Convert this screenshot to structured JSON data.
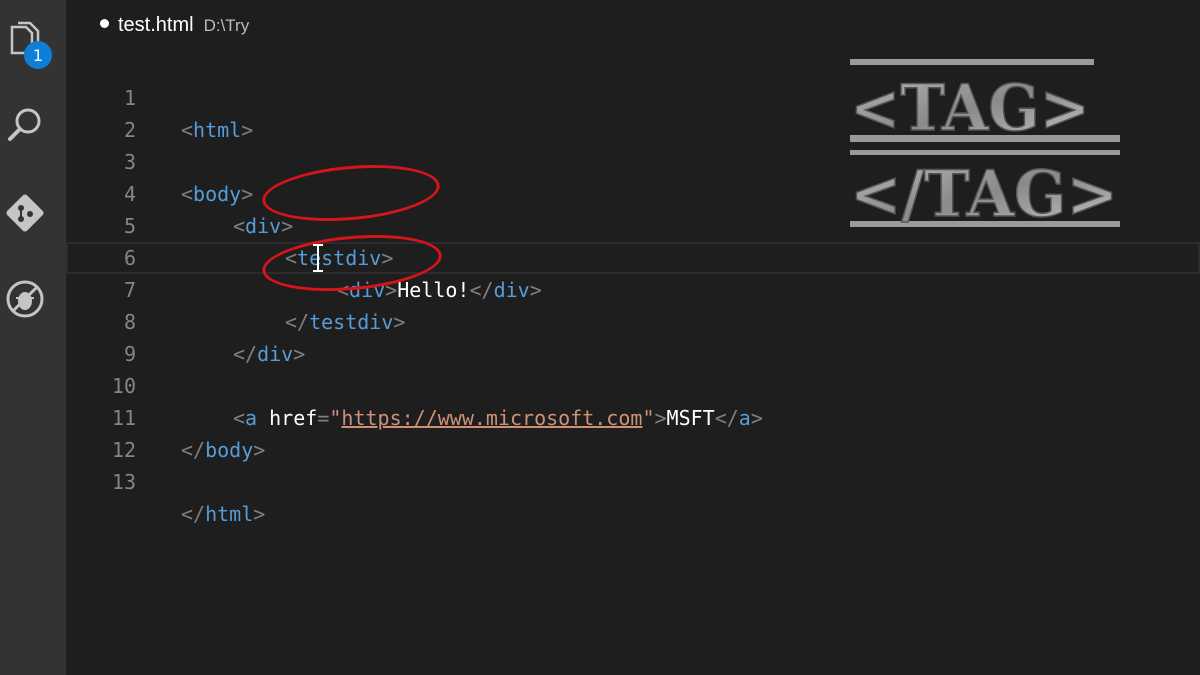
{
  "activity_bar": {
    "icons": [
      "files-icon",
      "search-icon",
      "source-control-icon",
      "debug-icon"
    ],
    "explorer_badge": "1"
  },
  "tab": {
    "filename": "test.html",
    "path": "D:\\Try",
    "dirty": true
  },
  "editor": {
    "current_line": 7,
    "lines": [
      {
        "n": "1",
        "tokens": {
          "open": "<",
          "tag": "html",
          "close": ">"
        }
      },
      {
        "n": "2"
      },
      {
        "n": "3",
        "tokens": {
          "open": "<",
          "tag": "body",
          "close": ">"
        }
      },
      {
        "n": "4",
        "tokens": {
          "open": "<",
          "tag": "div",
          "close": ">"
        }
      },
      {
        "n": "5",
        "tokens": {
          "open": "<",
          "tag": "testdiv",
          "close": ">"
        }
      },
      {
        "n": "6",
        "tokens": {
          "open": "<",
          "tag": "div",
          "close": ">",
          "text": "Hello!",
          "open2": "</",
          "tag2": "div",
          "close2": ">"
        }
      },
      {
        "n": "7",
        "tokens": {
          "open": "</",
          "tag": "testdiv",
          "close": ">"
        }
      },
      {
        "n": "8",
        "tokens": {
          "open": "</",
          "tag": "div",
          "close": ">"
        }
      },
      {
        "n": "9"
      },
      {
        "n": "10",
        "tokens": {
          "open": "<",
          "tag": "a",
          "attr": "href",
          "eq": "=",
          "q1": "\"",
          "url": "https://www.microsoft.com",
          "q2": "\"",
          "close": ">",
          "text": "MSFT",
          "open2": "</",
          "tag2": "a",
          "close2": ">"
        }
      },
      {
        "n": "11",
        "tokens": {
          "open": "</",
          "tag": "body",
          "close": ">"
        }
      },
      {
        "n": "12"
      },
      {
        "n": "13",
        "tokens": {
          "open": "</",
          "tag": "html",
          "close": ">"
        }
      }
    ]
  },
  "overlay": {
    "logo_line1": "<TAG>",
    "logo_line2": "</TAG>",
    "highlight_color": "#d8141b"
  }
}
